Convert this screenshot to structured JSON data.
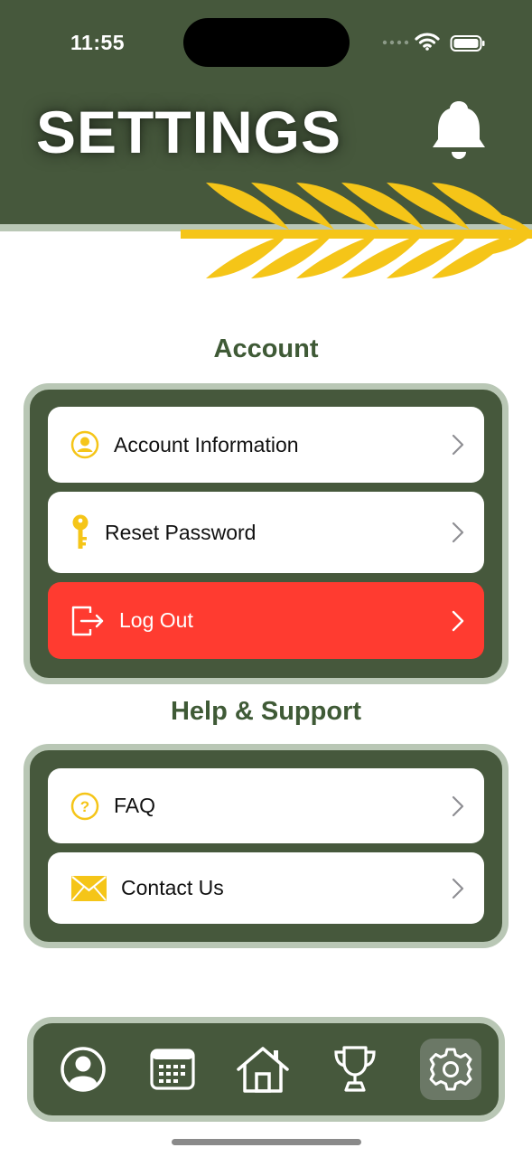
{
  "status_bar": {
    "time": "11:55"
  },
  "header": {
    "title": "SETTINGS",
    "notification_icon": "bell-icon"
  },
  "colors": {
    "header_bg": "#46583c",
    "border": "#b9c7b5",
    "accent_yellow": "#f5c518",
    "danger": "#ff3b30",
    "heading": "#3f5a36"
  },
  "account": {
    "heading": "Account",
    "items": [
      {
        "label": "Account Information",
        "icon": "user-circle-icon"
      },
      {
        "label": "Reset Password",
        "icon": "key-icon"
      },
      {
        "label": "Log Out",
        "icon": "logout-icon"
      }
    ]
  },
  "support": {
    "heading": "Help & Support",
    "items": [
      {
        "label": "FAQ",
        "icon": "question-circle-icon"
      },
      {
        "label": "Contact Us",
        "icon": "envelope-icon"
      }
    ]
  },
  "tab_bar": {
    "tabs": [
      {
        "icon": "profile-icon"
      },
      {
        "icon": "calendar-icon"
      },
      {
        "icon": "home-icon"
      },
      {
        "icon": "trophy-icon"
      },
      {
        "icon": "gear-icon",
        "active": true
      }
    ]
  }
}
